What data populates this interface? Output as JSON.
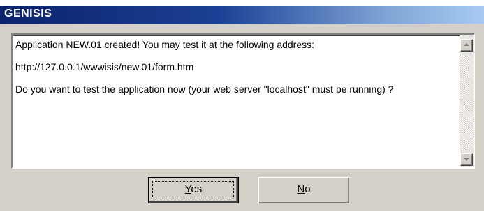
{
  "window": {
    "title": "GENISIS"
  },
  "message": {
    "line1": "Application NEW.01 created! You may test it at the following address:",
    "line2": "http://127.0.0.1/wwwisis/new.01/form.htm",
    "line3": "Do you want to test the application now (your web server \"localhost\" must be running) ?"
  },
  "buttons": {
    "yes": {
      "accel": "Y",
      "rest": "es",
      "label": "Yes"
    },
    "no": {
      "accel": "N",
      "rest": "o",
      "label": "No"
    }
  },
  "icons": {
    "scroll_up": "arrow-up-icon",
    "scroll_down": "arrow-down-icon"
  },
  "colors": {
    "title_gradient_start": "#0a246a",
    "title_gradient_end": "#a6caf0",
    "dialog_background": "#d4d0c8"
  }
}
